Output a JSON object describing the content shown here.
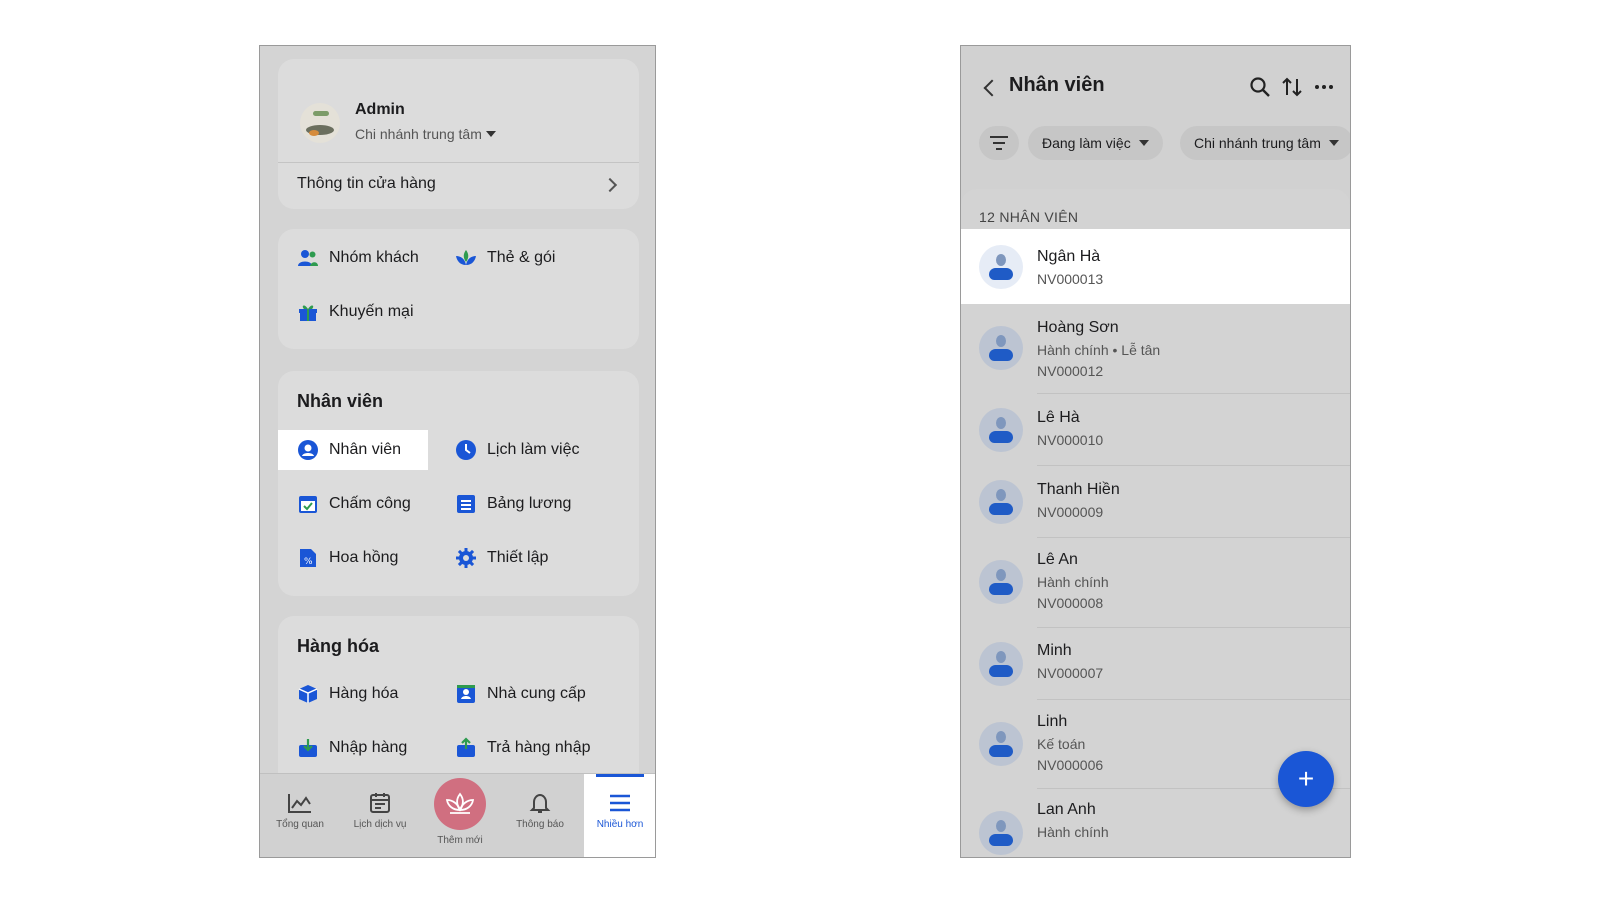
{
  "left_screen": {
    "store": {
      "name": "Admin",
      "branch": "Chi nhánh trung tâm",
      "info_link": "Thông tin cửa hàng"
    },
    "customer_section": {
      "items": [
        {
          "label": "Nhóm khách",
          "icon": "people-icon"
        },
        {
          "label": "Thẻ & gói",
          "icon": "lotus-icon"
        },
        {
          "label": "Khuyến mại",
          "icon": "gift-icon"
        }
      ]
    },
    "staff_section": {
      "title": "Nhân viên",
      "items": [
        {
          "label": "Nhân viên",
          "icon": "user-circle-icon",
          "selected": true
        },
        {
          "label": "Lịch làm việc",
          "icon": "clock-icon"
        },
        {
          "label": "Chấm công",
          "icon": "calendar-check-icon"
        },
        {
          "label": "Bảng lương",
          "icon": "list-icon"
        },
        {
          "label": "Hoa hồng",
          "icon": "percent-doc-icon"
        },
        {
          "label": "Thiết lập",
          "icon": "gear-icon"
        }
      ]
    },
    "goods_section": {
      "title": "Hàng hóa",
      "items": [
        {
          "label": "Hàng hóa",
          "icon": "box-icon"
        },
        {
          "label": "Nhà cung cấp",
          "icon": "contact-card-icon"
        },
        {
          "label": "Nhập hàng",
          "icon": "import-icon"
        },
        {
          "label": "Trả hàng nhập",
          "icon": "return-icon"
        }
      ]
    },
    "tabbar": [
      {
        "label": "Tổng quan",
        "icon": "chart-icon"
      },
      {
        "label": "Lịch dịch vụ",
        "icon": "calendar-icon"
      },
      {
        "label": "Thêm mới",
        "icon": "lotus-icon"
      },
      {
        "label": "Thông báo",
        "icon": "bell-icon"
      },
      {
        "label": "Nhiều hơn",
        "icon": "menu-icon",
        "active": true
      }
    ]
  },
  "right_screen": {
    "title": "Nhân viên",
    "filters": {
      "status": "Đang làm việc",
      "branch": "Chi nhánh trung tâm"
    },
    "count_label": "12 NHÂN VIÊN",
    "employees": [
      {
        "name": "Ngân Hà",
        "role": "",
        "code": "NV000013",
        "selected": true
      },
      {
        "name": "Hoàng Sơn",
        "role": "Hành chính • Lễ tân",
        "code": "NV000012"
      },
      {
        "name": "Lê Hà",
        "role": "",
        "code": "NV000010"
      },
      {
        "name": "Thanh Hiền",
        "role": "",
        "code": "NV000009"
      },
      {
        "name": "Lê An",
        "role": "Hành chính",
        "code": "NV000008"
      },
      {
        "name": "Minh",
        "role": "",
        "code": "NV000007"
      },
      {
        "name": "Linh",
        "role": "Kế toán",
        "code": "NV000006"
      },
      {
        "name": "Lan Anh",
        "role": "Hành chính",
        "code": ""
      }
    ],
    "fab_label": "+"
  },
  "colors": {
    "accent": "#1a56d6",
    "lotus": "#d06f80",
    "green": "#2e9b4f"
  }
}
